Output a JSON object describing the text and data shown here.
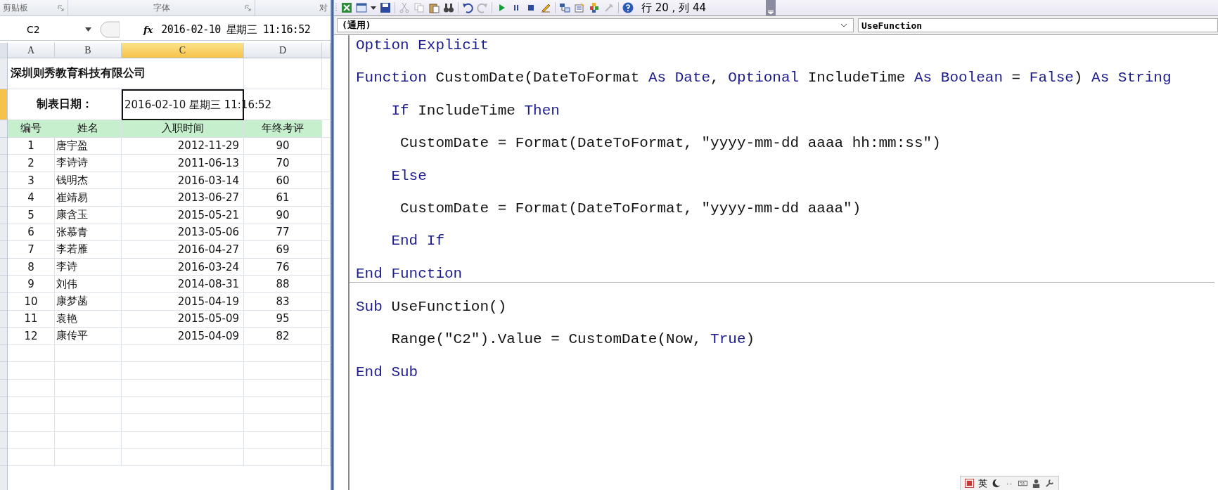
{
  "ribbon": {
    "groups": [
      {
        "label": "剪贴板",
        "launcher": true
      },
      {
        "label": "字体",
        "launcher": true
      },
      {
        "label": "对",
        "launcher": false
      }
    ]
  },
  "formula_bar": {
    "name_box": "C2",
    "fx_label": "fx",
    "value": "2016-02-10  星期三  11:16:52"
  },
  "sheet": {
    "columns": [
      {
        "label": "A",
        "selected": false
      },
      {
        "label": "B",
        "selected": false
      },
      {
        "label": "C",
        "selected": true
      },
      {
        "label": "D",
        "selected": false
      }
    ],
    "title": "深圳则秀教育科技有限公司",
    "date_label": "制表日期：",
    "date_value": "2016-02-10 星期三 11:16:52",
    "headers": [
      "编号",
      "姓名",
      "入职时间",
      "年终考评"
    ],
    "rows": [
      {
        "no": "1",
        "name": "唐宇盈",
        "date": "2012-11-29",
        "score": "90"
      },
      {
        "no": "2",
        "name": "李诗诗",
        "date": "2011-06-13",
        "score": "70"
      },
      {
        "no": "3",
        "name": "钱明杰",
        "date": "2016-03-14",
        "score": "60"
      },
      {
        "no": "4",
        "name": "崔靖易",
        "date": "2013-06-27",
        "score": "61"
      },
      {
        "no": "5",
        "name": "康含玉",
        "date": "2015-05-21",
        "score": "90"
      },
      {
        "no": "6",
        "name": "张慕青",
        "date": "2013-05-06",
        "score": "77"
      },
      {
        "no": "7",
        "name": "李若雁",
        "date": "2016-04-27",
        "score": "69"
      },
      {
        "no": "8",
        "name": "李诗",
        "date": "2016-03-24",
        "score": "76"
      },
      {
        "no": "9",
        "name": "刘伟",
        "date": "2014-08-31",
        "score": "88"
      },
      {
        "no": "10",
        "name": "康梦菡",
        "date": "2015-04-19",
        "score": "83"
      },
      {
        "no": "11",
        "name": "袁艳",
        "date": "2015-05-09",
        "score": "95"
      },
      {
        "no": "12",
        "name": "康传平",
        "date": "2015-04-09",
        "score": "82"
      }
    ]
  },
  "vba": {
    "status": "行 20 , 列 44",
    "object_combo": "(通用)",
    "procedure_combo": "UseFunction",
    "code_lines": [
      {
        "kind": "code",
        "segments": [
          {
            "text": "Option Explicit",
            "keyword": true
          }
        ]
      },
      {
        "kind": "blank"
      },
      {
        "kind": "code",
        "segments": [
          {
            "text": "Function",
            "keyword": true
          },
          {
            "text": " CustomDate(DateToFormat ",
            "keyword": false
          },
          {
            "text": "As Date",
            "keyword": true
          },
          {
            "text": ", ",
            "keyword": false
          },
          {
            "text": "Optional",
            "keyword": true
          },
          {
            "text": " IncludeTime ",
            "keyword": false
          },
          {
            "text": "As Boolean",
            "keyword": true
          },
          {
            "text": " = ",
            "keyword": false
          },
          {
            "text": "False",
            "keyword": true
          },
          {
            "text": ") ",
            "keyword": false
          },
          {
            "text": "As String",
            "keyword": true
          }
        ]
      },
      {
        "kind": "blank"
      },
      {
        "kind": "code",
        "segments": [
          {
            "text": "    If",
            "keyword": true
          },
          {
            "text": " IncludeTime ",
            "keyword": false
          },
          {
            "text": "Then",
            "keyword": true
          }
        ]
      },
      {
        "kind": "blank"
      },
      {
        "kind": "code",
        "segments": [
          {
            "text": "     CustomDate = Format(DateToFormat, \"yyyy-mm-dd aaaa hh:mm:ss\")",
            "keyword": false
          }
        ]
      },
      {
        "kind": "blank"
      },
      {
        "kind": "code",
        "segments": [
          {
            "text": "    Else",
            "keyword": true
          }
        ]
      },
      {
        "kind": "blank"
      },
      {
        "kind": "code",
        "segments": [
          {
            "text": "     CustomDate = Format(DateToFormat, \"yyyy-mm-dd aaaa\")",
            "keyword": false
          }
        ]
      },
      {
        "kind": "blank"
      },
      {
        "kind": "code",
        "segments": [
          {
            "text": "    End If",
            "keyword": true
          }
        ]
      },
      {
        "kind": "blank"
      },
      {
        "kind": "code",
        "segments": [
          {
            "text": "End Function",
            "keyword": true
          }
        ]
      },
      {
        "kind": "separator"
      },
      {
        "kind": "blank"
      },
      {
        "kind": "code",
        "segments": [
          {
            "text": "Sub",
            "keyword": true
          },
          {
            "text": " UseFunction()",
            "keyword": false
          }
        ]
      },
      {
        "kind": "blank"
      },
      {
        "kind": "code",
        "segments": [
          {
            "text": "    Range(\"C2\").Value = CustomDate(Now, ",
            "keyword": false
          },
          {
            "text": "True",
            "keyword": true
          },
          {
            "text": ")",
            "keyword": false
          }
        ]
      },
      {
        "kind": "blank"
      },
      {
        "kind": "code",
        "segments": [
          {
            "text": "End Sub",
            "keyword": true
          }
        ]
      }
    ]
  },
  "ime_bar": {
    "language": "英"
  }
}
